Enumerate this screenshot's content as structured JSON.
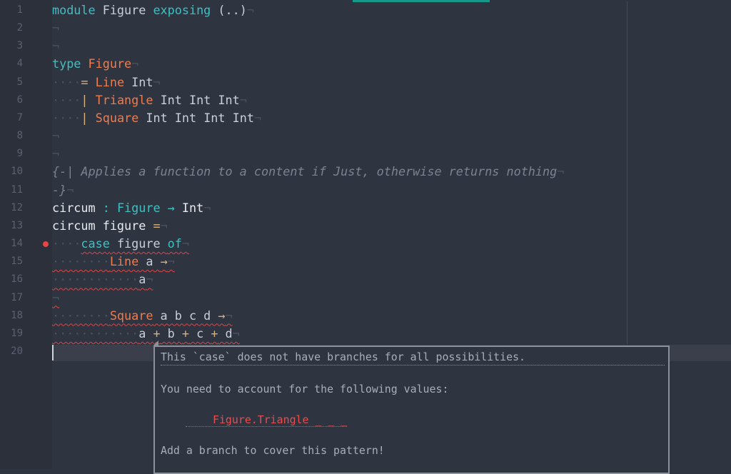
{
  "editor": {
    "accent": "#14998a",
    "lines": [
      {
        "n": "1",
        "tokens": [
          {
            "t": "module",
            "c": "k"
          },
          {
            "t": " Figure ",
            "c": "p"
          },
          {
            "t": "exposing",
            "c": "k"
          },
          {
            "t": " (..)",
            "c": "p"
          },
          {
            "t": "¬",
            "c": "inv"
          }
        ]
      },
      {
        "n": "2",
        "tokens": [
          {
            "t": "¬",
            "c": "inv"
          }
        ]
      },
      {
        "n": "3",
        "tokens": [
          {
            "t": "¬",
            "c": "inv"
          }
        ]
      },
      {
        "n": "4",
        "tokens": [
          {
            "t": "type",
            "c": "k"
          },
          {
            "t": " ",
            "c": "p"
          },
          {
            "t": "Figure",
            "c": "t"
          },
          {
            "t": "¬",
            "c": "inv"
          }
        ]
      },
      {
        "n": "5",
        "tokens": [
          {
            "t": "····",
            "c": "inv"
          },
          {
            "t": "= ",
            "c": "o"
          },
          {
            "t": "Line",
            "c": "t"
          },
          {
            "t": " Int",
            "c": "p"
          },
          {
            "t": "¬",
            "c": "inv"
          }
        ]
      },
      {
        "n": "6",
        "tokens": [
          {
            "t": "····",
            "c": "inv"
          },
          {
            "t": "| ",
            "c": "o"
          },
          {
            "t": "Triangle",
            "c": "t"
          },
          {
            "t": " Int Int Int",
            "c": "p"
          },
          {
            "t": "¬",
            "c": "inv"
          }
        ]
      },
      {
        "n": "7",
        "tokens": [
          {
            "t": "····",
            "c": "inv"
          },
          {
            "t": "| ",
            "c": "o"
          },
          {
            "t": "Square",
            "c": "t"
          },
          {
            "t": " Int Int Int Int",
            "c": "p"
          },
          {
            "t": "¬",
            "c": "inv"
          }
        ]
      },
      {
        "n": "8",
        "tokens": [
          {
            "t": "¬",
            "c": "inv"
          }
        ]
      },
      {
        "n": "9",
        "tokens": [
          {
            "t": "¬",
            "c": "inv"
          }
        ]
      },
      {
        "n": "10",
        "tokens": [
          {
            "t": "{-| Applies a function to a content if Just, otherwise returns nothing",
            "c": "c"
          },
          {
            "t": "¬",
            "c": "inv"
          }
        ]
      },
      {
        "n": "11",
        "tokens": [
          {
            "t": "-}",
            "c": "c"
          },
          {
            "t": "¬",
            "c": "inv"
          }
        ]
      },
      {
        "n": "12",
        "tokens": [
          {
            "t": "circum",
            "c": "w"
          },
          {
            "t": " : ",
            "c": "k"
          },
          {
            "t": "Figure",
            "c": "k"
          },
          {
            "t": " → ",
            "c": "k"
          },
          {
            "t": "Int",
            "c": "w"
          },
          {
            "t": "¬",
            "c": "inv"
          }
        ]
      },
      {
        "n": "13",
        "tokens": [
          {
            "t": "circum figure ",
            "c": "w"
          },
          {
            "t": "=",
            "c": "o"
          },
          {
            "t": "¬",
            "c": "inv"
          }
        ]
      },
      {
        "n": "14",
        "error": true,
        "tokens": [
          {
            "t": "····",
            "c": "inv"
          },
          {
            "t": "case",
            "c": "k",
            "e": true
          },
          {
            "t": " figure ",
            "c": "p",
            "e": true
          },
          {
            "t": "of",
            "c": "k",
            "e": true
          },
          {
            "t": "¬",
            "c": "inv",
            "e": true
          }
        ]
      },
      {
        "n": "15",
        "tokens": [
          {
            "t": "········",
            "c": "inv",
            "e": true
          },
          {
            "t": "Line",
            "c": "t",
            "e": true
          },
          {
            "t": " a ",
            "c": "p",
            "e": true
          },
          {
            "t": "→",
            "c": "o",
            "e": true
          },
          {
            "t": "¬",
            "c": "inv",
            "e": true
          }
        ]
      },
      {
        "n": "16",
        "tokens": [
          {
            "t": "············",
            "c": "inv",
            "e": true
          },
          {
            "t": "a",
            "c": "p",
            "e": true
          },
          {
            "t": "¬",
            "c": "inv",
            "e": true
          }
        ]
      },
      {
        "n": "17",
        "tokens": [
          {
            "t": "¬",
            "c": "inv",
            "e": true
          }
        ]
      },
      {
        "n": "18",
        "tokens": [
          {
            "t": "········",
            "c": "inv",
            "e": true
          },
          {
            "t": "Square",
            "c": "t",
            "e": true
          },
          {
            "t": " a b c d ",
            "c": "p",
            "e": true
          },
          {
            "t": "→",
            "c": "o",
            "e": true
          },
          {
            "t": "¬",
            "c": "inv",
            "e": true
          }
        ]
      },
      {
        "n": "19",
        "tokens": [
          {
            "t": "············",
            "c": "inv",
            "e": true
          },
          {
            "t": "a ",
            "c": "p",
            "e": true
          },
          {
            "t": "+",
            "c": "o",
            "e": true
          },
          {
            "t": " b ",
            "c": "p",
            "e": true
          },
          {
            "t": "+",
            "c": "o",
            "e": true
          },
          {
            "t": " c ",
            "c": "p",
            "e": true
          },
          {
            "t": "+",
            "c": "o",
            "e": true
          },
          {
            "t": " d",
            "c": "p",
            "e": true
          },
          {
            "t": "¬",
            "c": "inv",
            "e": true
          }
        ]
      },
      {
        "n": "20",
        "tokens": []
      }
    ]
  },
  "diagnostic": {
    "title": "This `case` does not have branches for all possibilities.",
    "body": "You need to account for the following values:",
    "missing": "Figure.Triangle _ _ _",
    "hint": "Add a branch to cover this pattern!"
  }
}
